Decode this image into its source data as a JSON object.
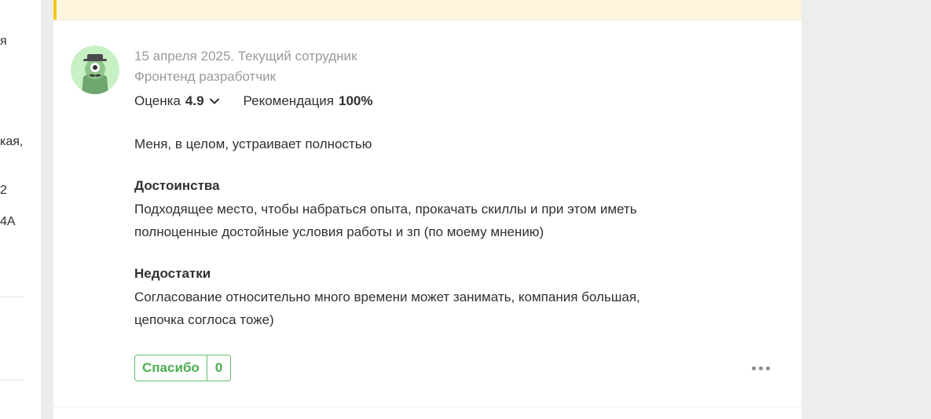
{
  "sidebar_fragments": [
    "я",
    "кая,",
    "2",
    "4А"
  ],
  "review": {
    "date_line": "15 апреля 2025. Текущий сотрудник",
    "position": "Фронтенд разработчик",
    "rating_label": "Оценка",
    "rating_value": "4.9",
    "recommend_label": "Рекомендация",
    "recommend_value": "100%",
    "summary": "Меня, в целом, устраивает полностью",
    "pros_title": "Достоинства",
    "pros_text": "Подходящее место, чтобы набраться опыта, прокачать скиллы и при этом иметь полноценные достойные условия работы и зп (по моему мнению)",
    "cons_title": "Недостатки",
    "cons_text": "Согласование относительно много времени может занимать, компания большая, цепочка соглоса тоже)",
    "thanks_label": "Спасибо",
    "thanks_count": "0"
  },
  "colors": {
    "accent_green": "#4caf50",
    "banner_yellow": "#fdf6dd",
    "banner_bar": "#f3c51a",
    "avatar_bg": "#c7f0c4"
  },
  "icons": {
    "avatar": "spy-monster-avatar-icon",
    "rating_toggle": "chevron-down-icon",
    "more": "more-dots-icon"
  }
}
